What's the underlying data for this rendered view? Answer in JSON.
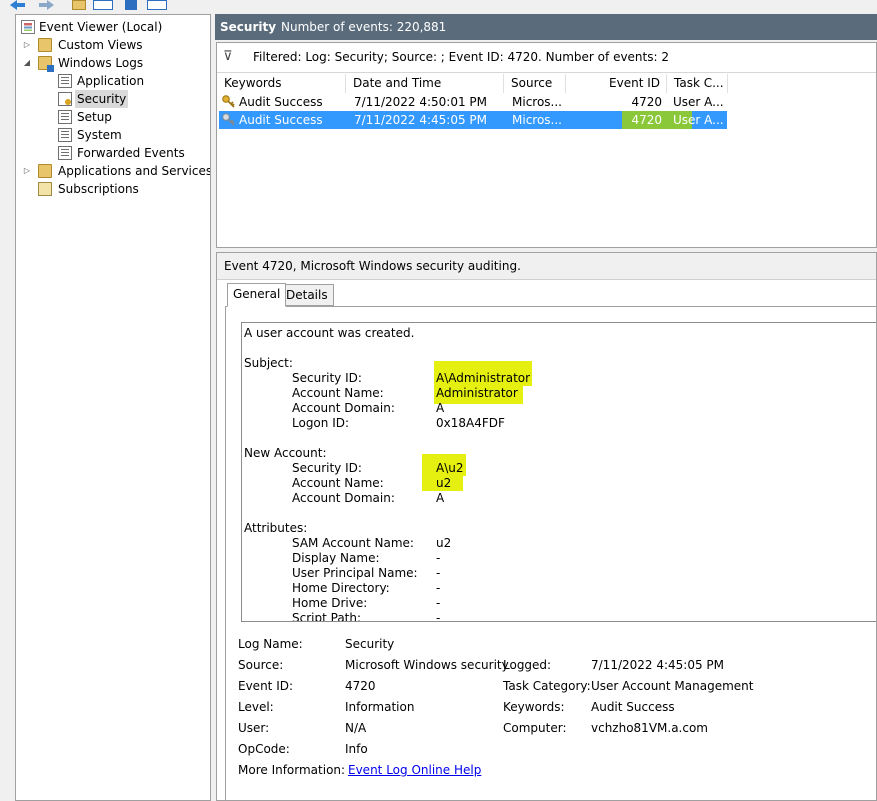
{
  "tree": {
    "root": "Event Viewer (Local)",
    "items": [
      {
        "label": "Custom Views"
      },
      {
        "label": "Windows Logs"
      },
      {
        "label": "Application"
      },
      {
        "label": "Security"
      },
      {
        "label": "Setup"
      },
      {
        "label": "System"
      },
      {
        "label": "Forwarded Events"
      },
      {
        "label": "Applications and Services Lo"
      },
      {
        "label": "Subscriptions"
      }
    ]
  },
  "header": {
    "title": "Security",
    "count_text": "Number of events: 220,881"
  },
  "filter": {
    "text": "Filtered: Log: Security; Source: ; Event ID: 4720. Number of events: 2"
  },
  "columns": {
    "keywords": "Keywords",
    "date": "Date and Time",
    "source": "Source",
    "event_id": "Event ID",
    "task": "Task C..."
  },
  "events": [
    {
      "keywords": "Audit Success",
      "date": "7/11/2022 4:50:01 PM",
      "source": "Micros...",
      "event_id": "4720",
      "task": "User A..."
    },
    {
      "keywords": "Audit Success",
      "date": "7/11/2022 4:45:05 PM",
      "source": "Micros...",
      "event_id": "4720",
      "task": "User A..."
    }
  ],
  "details": {
    "heading": "Event 4720, Microsoft Windows security auditing.",
    "tabs": {
      "general": "General",
      "details": "Details"
    },
    "message": {
      "line1": "A user account was created.",
      "subject": "Subject:",
      "subject_fields": [
        {
          "label": "Security ID:",
          "value": "A\\Administrator"
        },
        {
          "label": "Account Name:",
          "value": "Administrator"
        },
        {
          "label": "Account Domain:",
          "value": "A"
        },
        {
          "label": "Logon ID:",
          "value": "0x18A4FDF"
        }
      ],
      "new_account": "New Account:",
      "new_fields": [
        {
          "label": "Security ID:",
          "value": "A\\u2"
        },
        {
          "label": "Account Name:",
          "value": "u2"
        },
        {
          "label": "Account Domain:",
          "value": "A"
        }
      ],
      "attributes": "Attributes:",
      "attr_fields": [
        {
          "label": "SAM Account Name:",
          "value": "u2"
        },
        {
          "label": "Display Name:",
          "value": "-"
        },
        {
          "label": "User Principal Name:",
          "value": "-"
        },
        {
          "label": "Home Directory:",
          "value": "-"
        },
        {
          "label": "Home Drive:",
          "value": "-"
        },
        {
          "label": "Script Path:",
          "value": "-"
        }
      ]
    },
    "props": {
      "log_name_l": "Log Name:",
      "log_name_v": "Security",
      "source_l": "Source:",
      "source_v": "Microsoft Windows security",
      "logged_l": "Logged:",
      "logged_v": "7/11/2022 4:45:05 PM",
      "event_id_l": "Event ID:",
      "event_id_v": "4720",
      "task_cat_l": "Task Category:",
      "task_cat_v": "User Account Management",
      "level_l": "Level:",
      "level_v": "Information",
      "keywords_l": "Keywords:",
      "keywords_v": "Audit Success",
      "user_l": "User:",
      "user_v": "N/A",
      "computer_l": "Computer:",
      "computer_v": "vchzho81VM.a.com",
      "opcode_l": "OpCode:",
      "opcode_v": "Info",
      "more_info_l": "More Information:",
      "more_info_link": "Event Log Online Help"
    }
  },
  "colors": {
    "header_bg": "#5a6b7c",
    "selection": "#3399ff",
    "highlight": "#e5f010",
    "link": "#0000ee"
  }
}
